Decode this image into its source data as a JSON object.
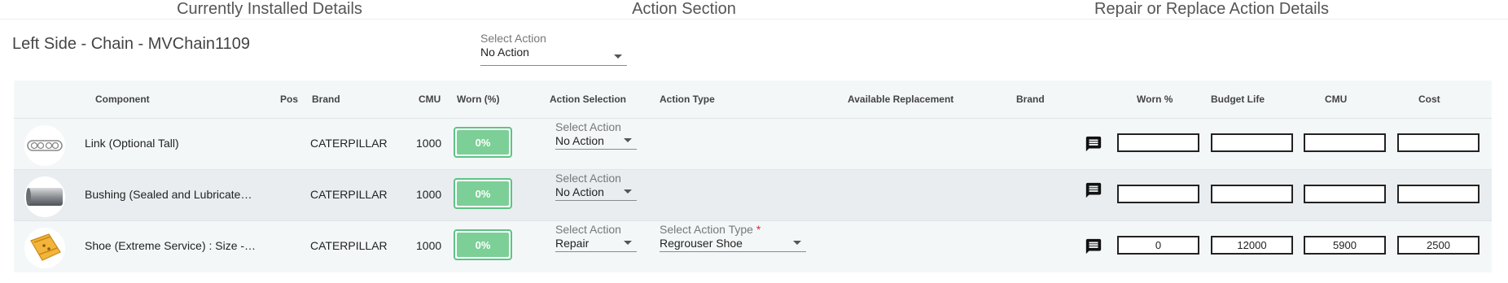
{
  "sections": {
    "installed": "Currently Installed Details",
    "action": "Action Section",
    "repair": "Repair or Replace Action Details"
  },
  "chain_title": "Left Side - Chain - MVChain1109",
  "top_select": {
    "label": "Select Action",
    "value": "No Action"
  },
  "columns": {
    "component": "Component",
    "pos": "Pos",
    "brand": "Brand",
    "cmu": "CMU",
    "worn": "Worn (%)",
    "action_selection": "Action Selection",
    "action_type": "Action Type",
    "available_replacement": "Available Replacement",
    "brand2": "Brand",
    "worn_pct": "Worn %",
    "budget_life": "Budget Life",
    "cmu2": "CMU",
    "cost": "Cost"
  },
  "rows": [
    {
      "thumb_icon": "chain-link-icon",
      "component": "Link (Optional Tall)",
      "pos": "",
      "brand": "CATERPILLAR",
      "cmu": "1000",
      "worn": "0%",
      "action_label": "Select Action",
      "action_value": "No Action",
      "action_type_label": "",
      "action_type_value": "",
      "worn_pct": "",
      "budget_life": "",
      "cmu_val": "",
      "cost": ""
    },
    {
      "thumb_icon": "bushing-icon",
      "component": "Bushing (Sealed and Lubricate…",
      "pos": "",
      "brand": "CATERPILLAR",
      "cmu": "1000",
      "worn": "0%",
      "action_label": "Select Action",
      "action_value": "No Action",
      "action_type_label": "",
      "action_type_value": "",
      "worn_pct": "",
      "budget_life": "",
      "cmu_val": "",
      "cost": ""
    },
    {
      "thumb_icon": "track-shoe-icon",
      "component": "Shoe (Extreme Service) : Size -…",
      "pos": "",
      "brand": "CATERPILLAR",
      "cmu": "1000",
      "worn": "0%",
      "action_label": "Select Action",
      "action_value": "Repair",
      "action_type_label": "Select Action Type",
      "action_type_required": "*",
      "action_type_value": "Regrouser Shoe",
      "worn_pct": "0",
      "budget_life": "12000",
      "cmu_val": "5900",
      "cost": "2500"
    }
  ],
  "colors": {
    "worn_green": "#7ccf96",
    "required": "#d32f2f"
  }
}
